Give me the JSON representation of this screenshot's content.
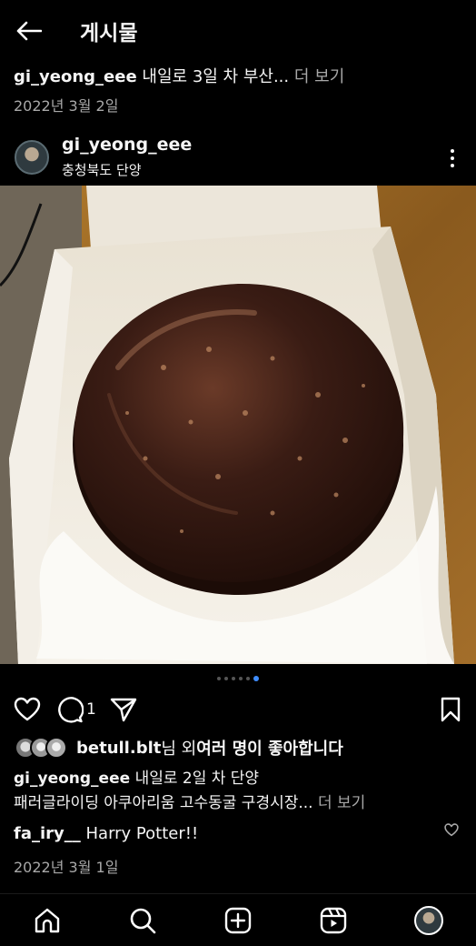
{
  "header": {
    "title": "게시물"
  },
  "prev_post": {
    "username": "gi_yeong_eee",
    "caption_preview": "내일로 3일 차 부산...",
    "more": "더 보기",
    "date": "2022년 3월 2일"
  },
  "post": {
    "username": "gi_yeong_eee",
    "location": "충청북도 단양",
    "carousel": {
      "count": 6,
      "active_index": 5
    },
    "comment_count": "1",
    "likes": {
      "first_user": "betull.blt",
      "suffix_1": "님 외 ",
      "others": "여러 명이 좋아합니다"
    },
    "caption": {
      "username": "gi_yeong_eee",
      "line1": "내일로 2일 차 단양",
      "line2": "패러글라이딩 아쿠아리움 고수동굴 구경시장...",
      "more": "더 보기"
    },
    "comment": {
      "username": "fa_iry__",
      "text": "Harry Potter!!"
    },
    "date": "2022년 3월 1일"
  },
  "colors": {
    "background": "#000000",
    "text": "#f5f5f5",
    "muted": "#a8a8a8",
    "accent": "#3f8dfd"
  },
  "icons": {
    "back": "arrow-left-icon",
    "more": "kebab-icon",
    "like": "heart-icon",
    "comment": "comment-icon",
    "share": "send-icon",
    "save": "bookmark-icon",
    "nav_home": "home-icon",
    "nav_search": "search-icon",
    "nav_create": "plus-square-icon",
    "nav_reels": "reels-icon"
  }
}
